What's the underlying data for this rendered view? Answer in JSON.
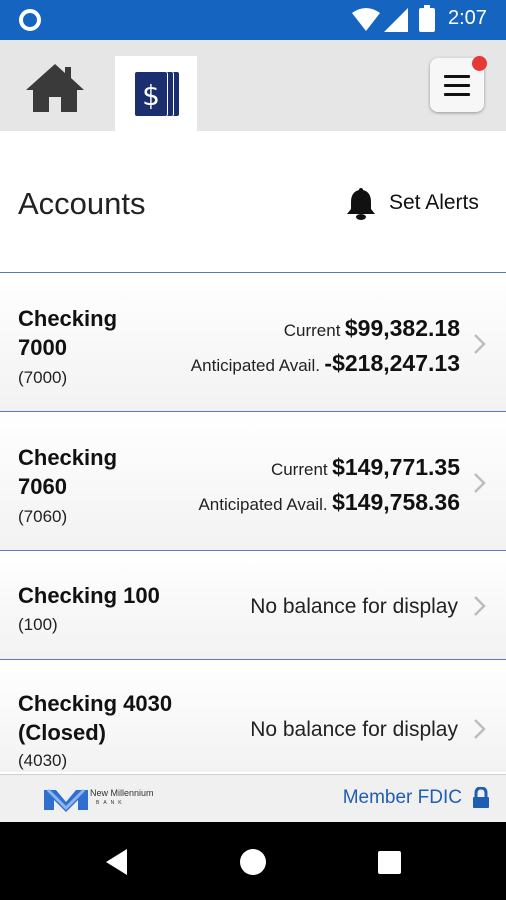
{
  "status_bar": {
    "time": "2:07",
    "icons": [
      "circle-notification-icon",
      "wifi-icon",
      "cell-signal-icon",
      "battery-icon"
    ]
  },
  "top_nav": {
    "tabs": [
      {
        "name": "home",
        "icon": "home-icon",
        "active": false
      },
      {
        "name": "accounts",
        "icon": "dollar-cards-icon",
        "active": true
      }
    ],
    "menu": {
      "icon": "hamburger-menu-icon",
      "has_notification": true
    }
  },
  "header": {
    "title": "Accounts",
    "alerts_label": "Set Alerts",
    "alerts_icon": "bell-icon"
  },
  "accounts": [
    {
      "name_line1": "Checking",
      "name_line2": "7000",
      "number": "(7000)",
      "current_label": "Current",
      "current_value": "$99,382.18",
      "avail_label": "Anticipated Avail.",
      "avail_value": "-$218,247.13"
    },
    {
      "name_line1": "Checking",
      "name_line2": "7060",
      "number": "(7060)",
      "current_label": "Current",
      "current_value": "$149,771.35",
      "avail_label": "Anticipated Avail.",
      "avail_value": "$149,758.36"
    },
    {
      "name_line1": "Checking 100",
      "number": "(100)",
      "no_balance": "No balance for display"
    },
    {
      "name_line1": "Checking 4030",
      "name_line2": "(Closed)",
      "number": "(4030)",
      "no_balance": "No balance for display"
    }
  ],
  "footer": {
    "logo_text": "New Millennium",
    "logo_sub": "BANK",
    "fdic_label": "Member FDIC",
    "fdic_icon": "lock-icon"
  },
  "colors": {
    "status_bar": "#1565c0",
    "accent": "#1e5fb4",
    "divider": "#5b78b8",
    "notification": "#e53935"
  }
}
